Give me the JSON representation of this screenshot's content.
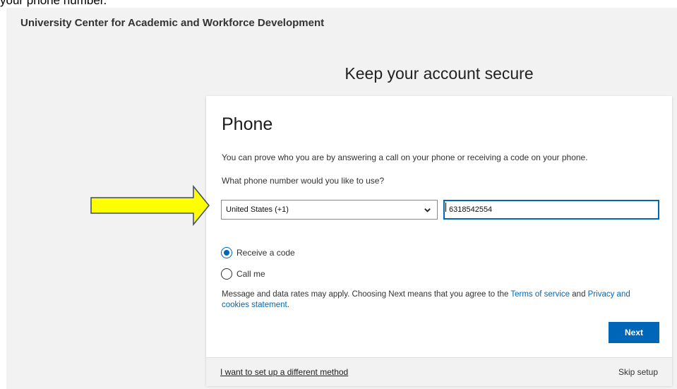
{
  "caption": "your phone number.",
  "header": {
    "org_name": "University Center for Academic and Workforce Development"
  },
  "page": {
    "heading": "Keep your account secure"
  },
  "card": {
    "title": "Phone",
    "description": "You can prove who you are by answering a call on your phone or receiving a code on your phone.",
    "question": "What phone number would you like to use?",
    "country_select": {
      "selected": "United States (+1)"
    },
    "phone_input": {
      "value": "6318542554"
    },
    "options": [
      {
        "label": "Receive a code",
        "checked": true
      },
      {
        "label": "Call me",
        "checked": false
      }
    ],
    "rates_text_prefix": "Message and data rates may apply. Choosing Next means that you agree to the ",
    "terms_link": "Terms of service",
    "rates_text_and": " and ",
    "privacy_link": "Privacy and cookies statement",
    "rates_text_suffix": ".",
    "next_label": "Next",
    "footer": {
      "different_method_link": "I want to set up a different method",
      "skip_label": "Skip setup"
    }
  },
  "annotation": {
    "arrow_color": "#ffff00",
    "arrow_outline": "#3a4a6b",
    "icon": "right-arrow-icon"
  },
  "colors": {
    "accent": "#0067b8",
    "background": "#f2f2f2"
  }
}
